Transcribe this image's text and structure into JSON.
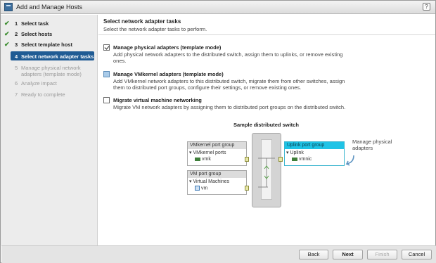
{
  "window": {
    "title": "Add and Manage Hosts",
    "help_label": "?"
  },
  "steps": [
    {
      "num": "1",
      "label": "Select task",
      "state": "done"
    },
    {
      "num": "2",
      "label": "Select hosts",
      "state": "done"
    },
    {
      "num": "3",
      "label": "Select template host",
      "state": "done"
    },
    {
      "num": "4",
      "label": "Select network adapter tasks",
      "state": "active"
    },
    {
      "num": "5",
      "label": "Manage physical network adapters (template mode)",
      "state": "pending"
    },
    {
      "num": "6",
      "label": "Analyze impact",
      "state": "pending"
    },
    {
      "num": "7",
      "label": "Ready to complete",
      "state": "pending"
    }
  ],
  "header": {
    "title": "Select network adapter tasks",
    "subtitle": "Select the network adapter tasks to perform."
  },
  "options": [
    {
      "title": "Manage physical adapters (template mode)",
      "desc": "Add physical network adapters to the distributed switch, assign them to uplinks, or remove existing ones.",
      "state": "checked"
    },
    {
      "title": "Manage VMkernel adapters (template mode)",
      "desc": "Add VMkernel network adapters to this distributed switch, migrate them from other switches, assign them to distributed port groups, configure their settings, or remove existing ones.",
      "state": "partial"
    },
    {
      "title": "Migrate virtual machine networking",
      "desc": "Migrate VM network adapters by assigning them to distributed port groups on the distributed switch.",
      "state": "unchecked"
    }
  ],
  "diagram": {
    "title": "Sample distributed switch",
    "vmkernel": {
      "header": "VMkernel port group",
      "sub": "▾ VMkernel ports",
      "item": "vmk"
    },
    "vm": {
      "header": "VM port group",
      "sub": "▾ Virtual Machines",
      "item": "vm"
    },
    "uplink": {
      "header": "Uplink port group",
      "sub": "▾ Uplink",
      "item": "vmnic"
    },
    "callout": "Manage physical adapters",
    "highlight_color": "#1fc3e6"
  },
  "footer": {
    "back": "Back",
    "next": "Next",
    "finish": "Finish",
    "cancel": "Cancel"
  }
}
